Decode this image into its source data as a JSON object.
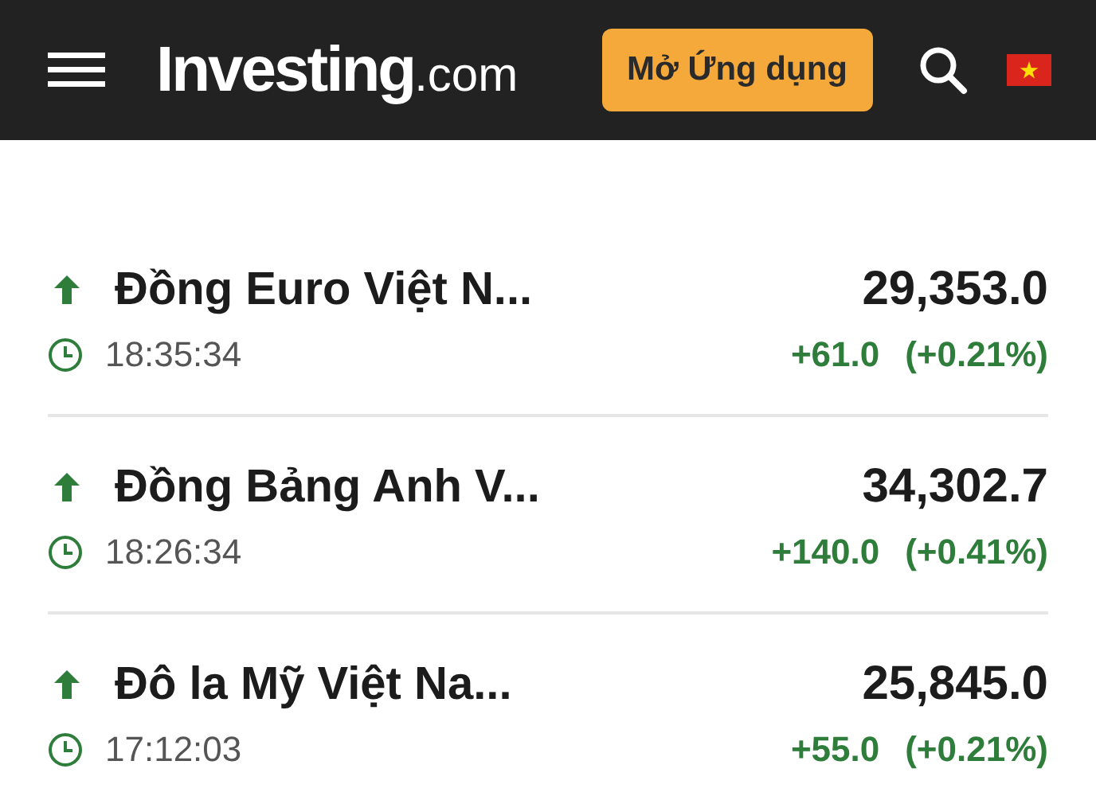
{
  "header": {
    "logo": {
      "name": "Investing",
      "suffix": ".com"
    },
    "open_app_button": "Mở Ứng dụng"
  },
  "quotes": [
    {
      "name": "Đồng Euro Việt N...",
      "rising": true,
      "time": "18:35:34",
      "price": "29,353.0",
      "change": "+61.0",
      "change_percent": "(+0.21%)"
    },
    {
      "name": "Đồng Bảng Anh V...",
      "rising": true,
      "time": "18:26:34",
      "price": "34,302.7",
      "change": "+140.0",
      "change_percent": "(+0.41%)"
    },
    {
      "name": "Đô la Mỹ Việt Na...",
      "rising": true,
      "time": "17:12:03",
      "price": "25,845.0",
      "change": "+55.0",
      "change_percent": "(+0.21%)"
    }
  ]
}
